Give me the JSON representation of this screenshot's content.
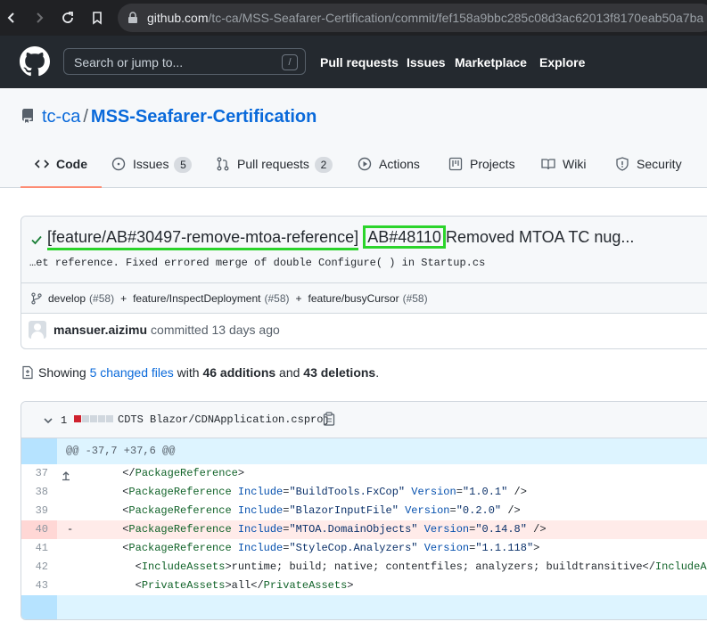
{
  "browser": {
    "url_host": "github.com",
    "url_path": "/tc-ca/MSS-Seafarer-Certification/commit/fef158a9bbc285c08d3ac62013f8170eab50a7ba"
  },
  "header": {
    "search_placeholder": "Search or jump to...",
    "slash_key": "/",
    "nav": [
      "Pull requests",
      "Issues",
      "Marketplace",
      "Explore"
    ]
  },
  "repo": {
    "owner": "tc-ca",
    "separator": "/",
    "name": "MSS-Seafarer-Certification",
    "tabs": [
      {
        "label": "Code"
      },
      {
        "label": "Issues",
        "count": "5"
      },
      {
        "label": "Pull requests",
        "count": "2"
      },
      {
        "label": "Actions"
      },
      {
        "label": "Projects"
      },
      {
        "label": "Wiki"
      },
      {
        "label": "Security"
      }
    ]
  },
  "commit": {
    "title_part1": "[feature/AB#30497-remove-mtoa-reference]",
    "title_part2": "AB#48110",
    "title_part3": "Removed MTOA TC nug...",
    "description": "…et reference. Fixed errored merge of double Configure( ) in Startup.cs",
    "branches": [
      {
        "name": "develop",
        "pr": "(#58)"
      },
      {
        "name": "feature/InspectDeployment",
        "pr": "(#58)"
      },
      {
        "name": "feature/busyCursor",
        "pr": "(#58)"
      }
    ],
    "branch_joiner": "+",
    "author": "mansuer.aizimu",
    "committed": "committed 13 days ago"
  },
  "summary": {
    "showing": "Showing",
    "changed_files": "5 changed files",
    "with": "with",
    "additions": "46 additions",
    "and": "and",
    "deletions": "43 deletions",
    "period": "."
  },
  "file": {
    "count": "1",
    "filename": "CDTS Blazor/CDNApplication.csproj",
    "hunk": "@@ -37,7 +37,6 @@",
    "diffstat_colors": [
      "#cf222e",
      "#d0d7de",
      "#d0d7de",
      "#d0d7de",
      "#d0d7de"
    ],
    "lines": [
      {
        "num": "37",
        "mark": "",
        "indent": "      ",
        "open": "</",
        "tag": "PackageReference",
        "parts": [],
        "close": ">"
      },
      {
        "num": "38",
        "mark": "",
        "indent": "      ",
        "open": "<",
        "tag": "PackageReference",
        "parts": [
          [
            "Include",
            "\"BuildTools.FxCop\""
          ],
          [
            "Version",
            "\"1.0.1\""
          ]
        ],
        "close": " />"
      },
      {
        "num": "39",
        "mark": "",
        "indent": "      ",
        "open": "<",
        "tag": "PackageReference",
        "parts": [
          [
            "Include",
            "\"BlazorInputFile\""
          ],
          [
            "Version",
            "\"0.2.0\""
          ]
        ],
        "close": " />"
      },
      {
        "num": "40",
        "mark": "-",
        "indent": "      ",
        "open": "<",
        "tag": "PackageReference",
        "parts": [
          [
            "Include",
            "\"MTOA.DomainObjects\""
          ],
          [
            "Version",
            "\"0.14.8\""
          ]
        ],
        "close": " />"
      },
      {
        "num": "41",
        "mark": "",
        "indent": "      ",
        "open": "<",
        "tag": "PackageReference",
        "parts": [
          [
            "Include",
            "\"StyleCop.Analyzers\""
          ],
          [
            "Version",
            "\"1.1.118\""
          ]
        ],
        "close": ">"
      },
      {
        "num": "42",
        "mark": "",
        "indent": "        ",
        "open": "<",
        "tag": "IncludeAssets",
        "parts": [],
        "close": ">",
        "text": "runtime; build; native; contentfiles; analyzers; buildtransitive",
        "end_tag": "IncludeAssets"
      },
      {
        "num": "43",
        "mark": "",
        "indent": "        ",
        "open": "<",
        "tag": "PrivateAssets",
        "parts": [],
        "close": ">",
        "text": "all",
        "end_tag": "PrivateAssets"
      }
    ]
  }
}
